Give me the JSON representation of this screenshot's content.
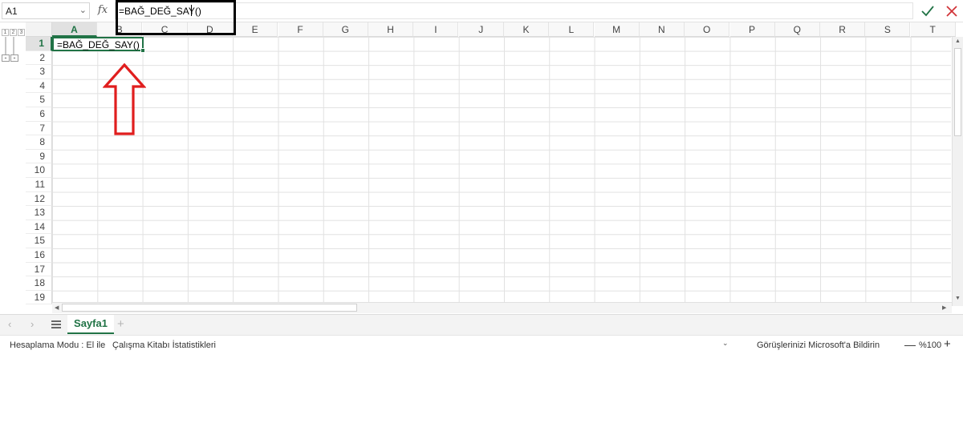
{
  "formula_bar": {
    "name_box": "A1",
    "fx_label": "fx",
    "formula": "=BAĞ_DEĞ_SAY()"
  },
  "outline": {
    "levels": [
      "1",
      "2",
      "3"
    ],
    "collapse_buttons": [
      "-",
      "-"
    ]
  },
  "columns": [
    "A",
    "B",
    "C",
    "D",
    "E",
    "F",
    "G",
    "H",
    "I",
    "J",
    "K",
    "L",
    "M",
    "N",
    "O",
    "P",
    "Q",
    "R",
    "S",
    "T"
  ],
  "rows": [
    "1",
    "2",
    "3",
    "4",
    "5",
    "6",
    "7",
    "8",
    "9",
    "10",
    "11",
    "12",
    "13",
    "14",
    "15",
    "16",
    "17",
    "18",
    "19"
  ],
  "active_cell": {
    "ref": "A1",
    "value": "=BAĞ_DEĞ_SAY()"
  },
  "sheets": {
    "tabs": [
      "Sayfa1"
    ],
    "active": "Sayfa1",
    "add_label": "+"
  },
  "status_bar": {
    "calc_mode": "Hesaplama Modu : El ile",
    "workbook_stats": "Çalışma Kitabı İstatistikleri",
    "feedback": "Görüşlerinizi Microsoft'a Bildirin",
    "zoom": "%100"
  },
  "colors": {
    "accent": "#217346",
    "highlight_box": "#000000",
    "arrow": "#e01e1e"
  }
}
